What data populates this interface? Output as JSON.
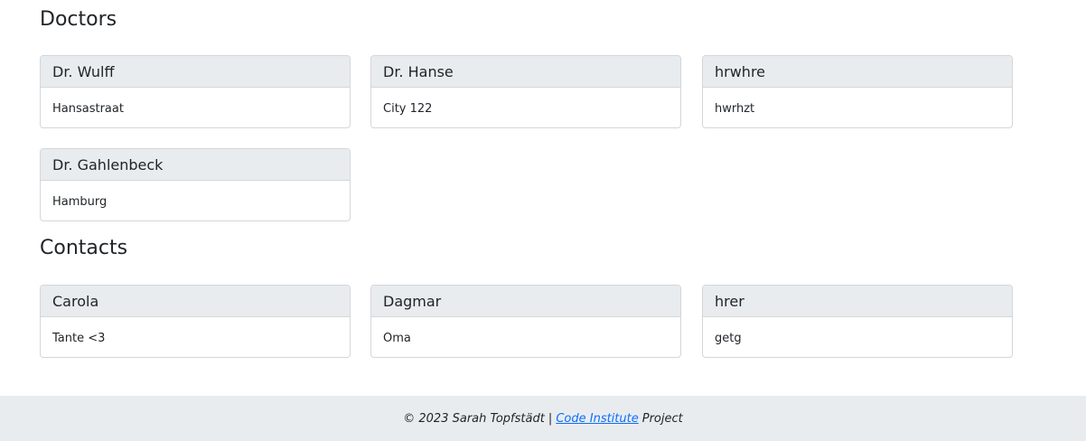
{
  "doctors": {
    "title": "Doctors",
    "cards": [
      {
        "name": "Dr. Wulff",
        "detail": "Hansastraat"
      },
      {
        "name": "Dr. Hanse",
        "detail": "City 122"
      },
      {
        "name": "hrwhre",
        "detail": "hwrhzt"
      },
      {
        "name": "Dr. Gahlenbeck",
        "detail": "Hamburg"
      }
    ]
  },
  "contacts": {
    "title": "Contacts",
    "cards": [
      {
        "name": "Carola",
        "detail": "Tante <3"
      },
      {
        "name": "Dagmar",
        "detail": "Oma"
      },
      {
        "name": "hrer",
        "detail": "getg"
      }
    ]
  },
  "footer": {
    "prefix": "© 2023 Sarah Topfstädt |",
    "link_text": "Code Institute",
    "suffix": "Project"
  }
}
